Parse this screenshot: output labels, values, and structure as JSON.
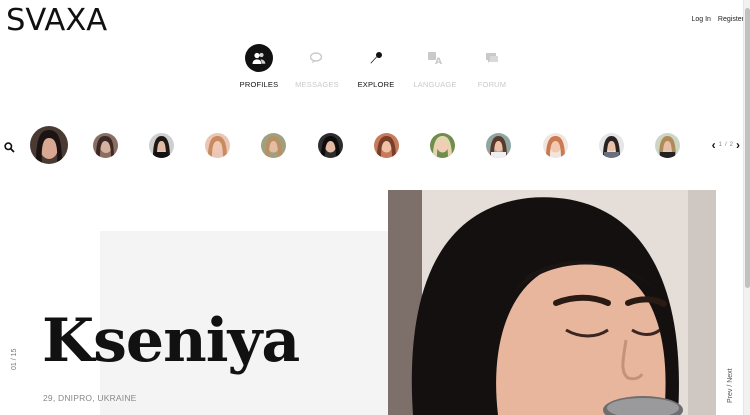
{
  "brand": {
    "logo": "SVAXA"
  },
  "header": {
    "login": "Log In",
    "register": "Register"
  },
  "nav": {
    "profiles": "PROFILES",
    "messages": "MESSAGES",
    "explore": "EXPLORE",
    "language": "LANGUAGE",
    "forum": "FORUM",
    "active": "profiles"
  },
  "strip": {
    "pager_current": "1",
    "pager_sep": "/",
    "pager_total": "2",
    "prev_icon": "chevron-left-icon",
    "next_icon": "chevron-right-icon",
    "search_icon": "search-icon"
  },
  "profile": {
    "name": "Kseniya",
    "meta": "29, DNIPRO, UKRAINE",
    "counter": "01 / 15",
    "prev_next": "Prev / Next"
  },
  "colors": {
    "text": "#111111",
    "muted": "#c9c9c9",
    "panel": "#f4f4f4"
  }
}
